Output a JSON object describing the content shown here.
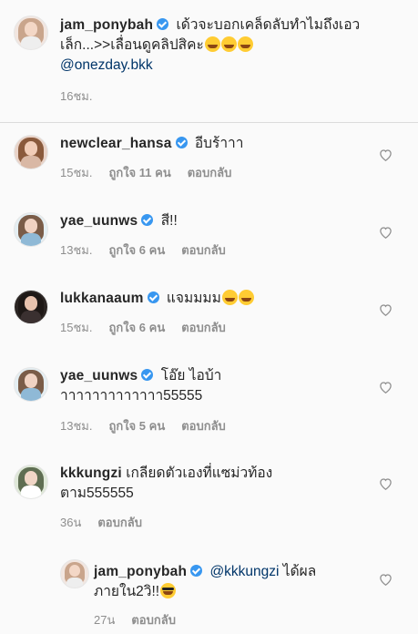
{
  "caption": {
    "username": "jam_ponybah",
    "text": "เด้วจะบอกเคล็ดลับทำไมถึงเอวเล็ก...>>เลื่อนดูคลิปสิคะ",
    "mention": "@onezday.bkk",
    "time": "16ชม."
  },
  "comments": [
    {
      "username": "newclear_hansa",
      "verified": true,
      "text": "อีบร้าาา",
      "time": "15ชม.",
      "likes": "ถูกใจ 11 คน",
      "reply_label": "ตอบกลับ"
    },
    {
      "username": "yae_uunws",
      "verified": true,
      "text": "สี!!",
      "time": "13ชม.",
      "likes": "ถูกใจ 6 คน",
      "reply_label": "ตอบกลับ"
    },
    {
      "username": "lukkanaaum",
      "verified": true,
      "text": "แจมมมม",
      "time": "15ชม.",
      "likes": "ถูกใจ 6 คน",
      "reply_label": "ตอบกลับ"
    },
    {
      "username": "yae_uunws",
      "verified": true,
      "text_line1": "โอ๊ย ไอบ้า",
      "text_line2": "าาาาาาาาาาาาา55555",
      "time": "13ชม.",
      "likes": "ถูกใจ 5 คน",
      "reply_label": "ตอบกลับ"
    },
    {
      "username": "kkkungzi",
      "verified": false,
      "text_line1": "เกลียดตัวเองที่แซม่วท้อง",
      "text_line2": "ตาม555555",
      "time": "36น",
      "reply_label": "ตอบกลับ"
    }
  ],
  "reply": {
    "username": "jam_ponybah",
    "verified": true,
    "mention": "@kkkungzi",
    "text_line1": "ได้ผล",
    "text_line2": "ภายใน2วิ!!",
    "time": "27น",
    "reply_label": "ตอบกลับ"
  },
  "colors": {
    "verified": "#3897f0",
    "mention": "#003569",
    "meta": "#8e8e8e",
    "text": "#262626",
    "background": "#fafafa"
  },
  "icons": {
    "like": "heart-outline-icon",
    "verified": "verified-badge-icon"
  }
}
